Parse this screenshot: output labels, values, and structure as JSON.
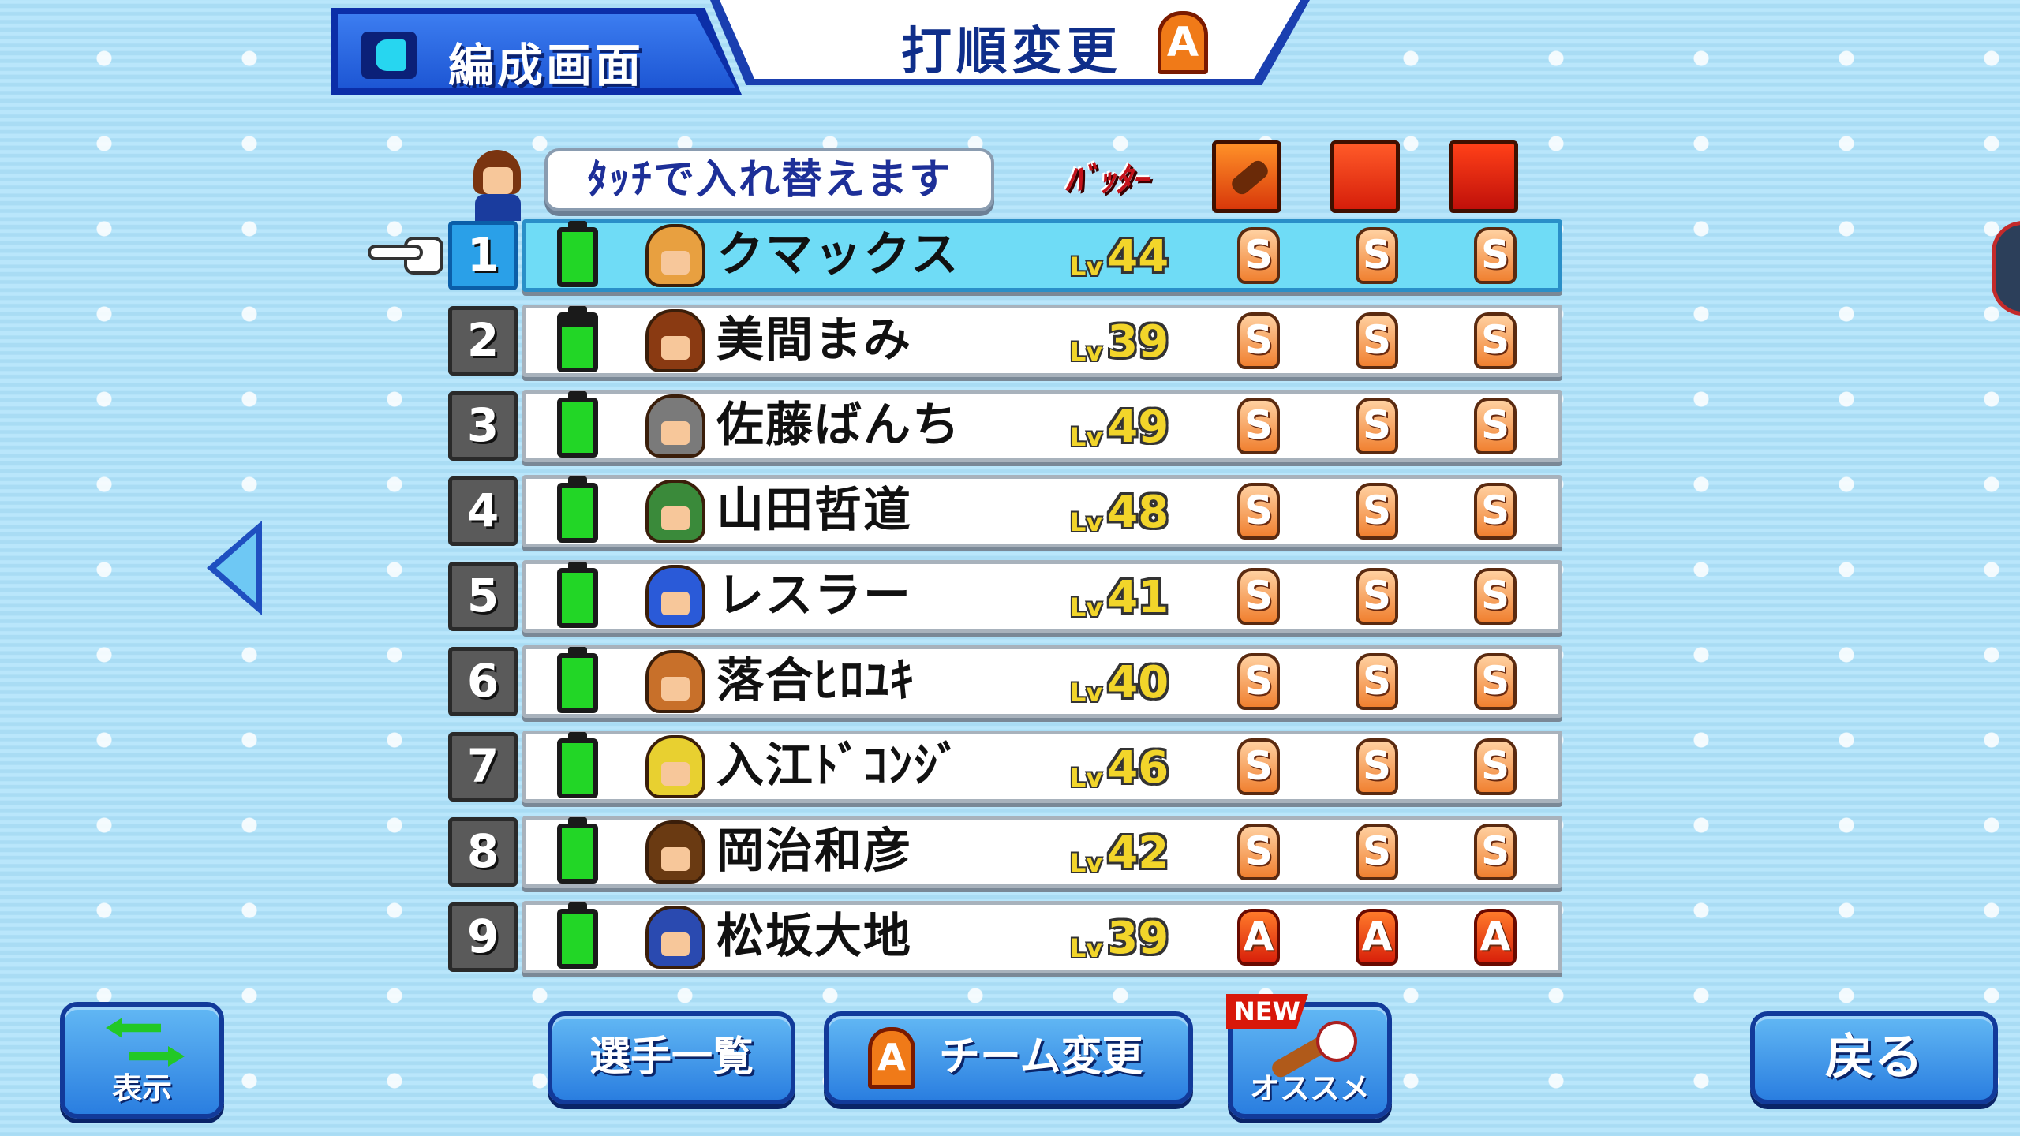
{
  "header": {
    "back_tab_label": "編成画面",
    "title": "打順変更",
    "title_badge": "A"
  },
  "column_header": {
    "hint": "ﾀｯﾁで入れ替えます",
    "batter_label": "ﾊﾞｯﾀｰ"
  },
  "lineup": [
    {
      "order": "1",
      "name": "クマックス",
      "lv_label": "Lv",
      "level": "44",
      "grades": [
        "S",
        "S",
        "S"
      ],
      "stamina_pct": 100,
      "selected": true,
      "face_color": "#e8a040"
    },
    {
      "order": "2",
      "name": "美間まみ",
      "lv_label": "Lv",
      "level": "39",
      "grades": [
        "S",
        "S",
        "S"
      ],
      "stamina_pct": 80,
      "selected": false,
      "face_color": "#8a3a12"
    },
    {
      "order": "3",
      "name": "佐藤ばんち",
      "lv_label": "Lv",
      "level": "49",
      "grades": [
        "S",
        "S",
        "S"
      ],
      "stamina_pct": 100,
      "selected": false,
      "face_color": "#7a7a7a"
    },
    {
      "order": "4",
      "name": "山田哲道",
      "lv_label": "Lv",
      "level": "48",
      "grades": [
        "S",
        "S",
        "S"
      ],
      "stamina_pct": 100,
      "selected": false,
      "face_color": "#3a8a3a"
    },
    {
      "order": "5",
      "name": "レスラー",
      "lv_label": "Lv",
      "level": "41",
      "grades": [
        "S",
        "S",
        "S"
      ],
      "stamina_pct": 100,
      "selected": false,
      "face_color": "#2a5ad8"
    },
    {
      "order": "6",
      "name": "落合ﾋﾛﾕｷ",
      "lv_label": "Lv",
      "level": "40",
      "grades": [
        "S",
        "S",
        "S"
      ],
      "stamina_pct": 100,
      "selected": false,
      "face_color": "#c8702a"
    },
    {
      "order": "7",
      "name": "入江ﾄﾞｺﾝｼﾞ",
      "lv_label": "Lv",
      "level": "46",
      "grades": [
        "S",
        "S",
        "S"
      ],
      "stamina_pct": 100,
      "selected": false,
      "face_color": "#e8d030"
    },
    {
      "order": "8",
      "name": "岡治和彦",
      "lv_label": "Lv",
      "level": "42",
      "grades": [
        "S",
        "S",
        "S"
      ],
      "stamina_pct": 100,
      "selected": false,
      "face_color": "#6a3a12"
    },
    {
      "order": "9",
      "name": "松坂大地",
      "lv_label": "Lv",
      "level": "39",
      "grades": [
        "A",
        "A",
        "A"
      ],
      "stamina_pct": 100,
      "selected": false,
      "face_color": "#2a4ab0"
    }
  ],
  "buttons": {
    "display": "表示",
    "players": "選手一覧",
    "team_badge": "A",
    "team": "チーム変更",
    "recommend_new": "NEW",
    "recommend": "オススメ",
    "back": "戻る"
  },
  "colors": {
    "background": "#aee0f7",
    "selected_row": "#6fdcf6",
    "stamina": "#22d626",
    "title_text": "#0f2e8a"
  }
}
